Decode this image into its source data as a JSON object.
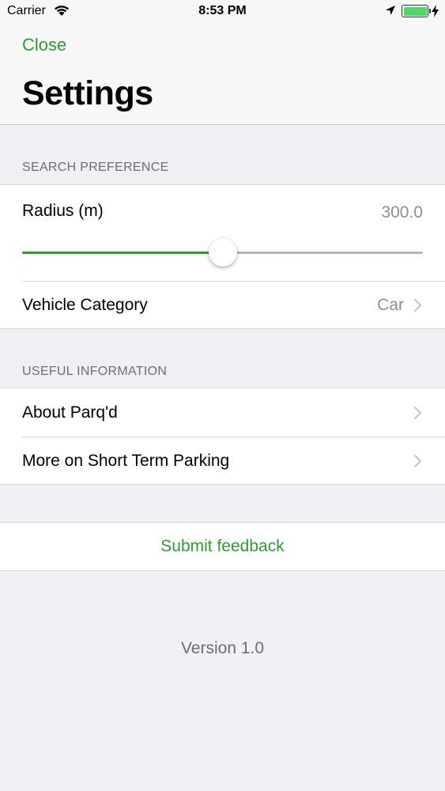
{
  "status_bar": {
    "carrier": "Carrier",
    "time": "8:53 PM",
    "icons": [
      "wifi-icon",
      "location-arrow-icon",
      "battery-icon",
      "charging-bolt-icon"
    ]
  },
  "header": {
    "close_label": "Close",
    "title": "Settings"
  },
  "search_preference": {
    "section_title": "SEARCH PREFERENCE",
    "radius": {
      "label": "Radius (m)",
      "value": "300.0",
      "slider_fraction": 0.5
    },
    "vehicle_category": {
      "label": "Vehicle Category",
      "value": "Car"
    }
  },
  "useful_information": {
    "section_title": "USEFUL INFORMATION",
    "items": [
      {
        "label": "About Parq'd"
      },
      {
        "label": "More on Short Term Parking"
      }
    ]
  },
  "feedback": {
    "label": "Submit feedback"
  },
  "footer": {
    "version": "Version 1.0"
  },
  "colors": {
    "accent": "#2d9d32",
    "background": "#efeff4",
    "secondary_text": "#8e8e93",
    "section_text": "#6d6d72"
  }
}
